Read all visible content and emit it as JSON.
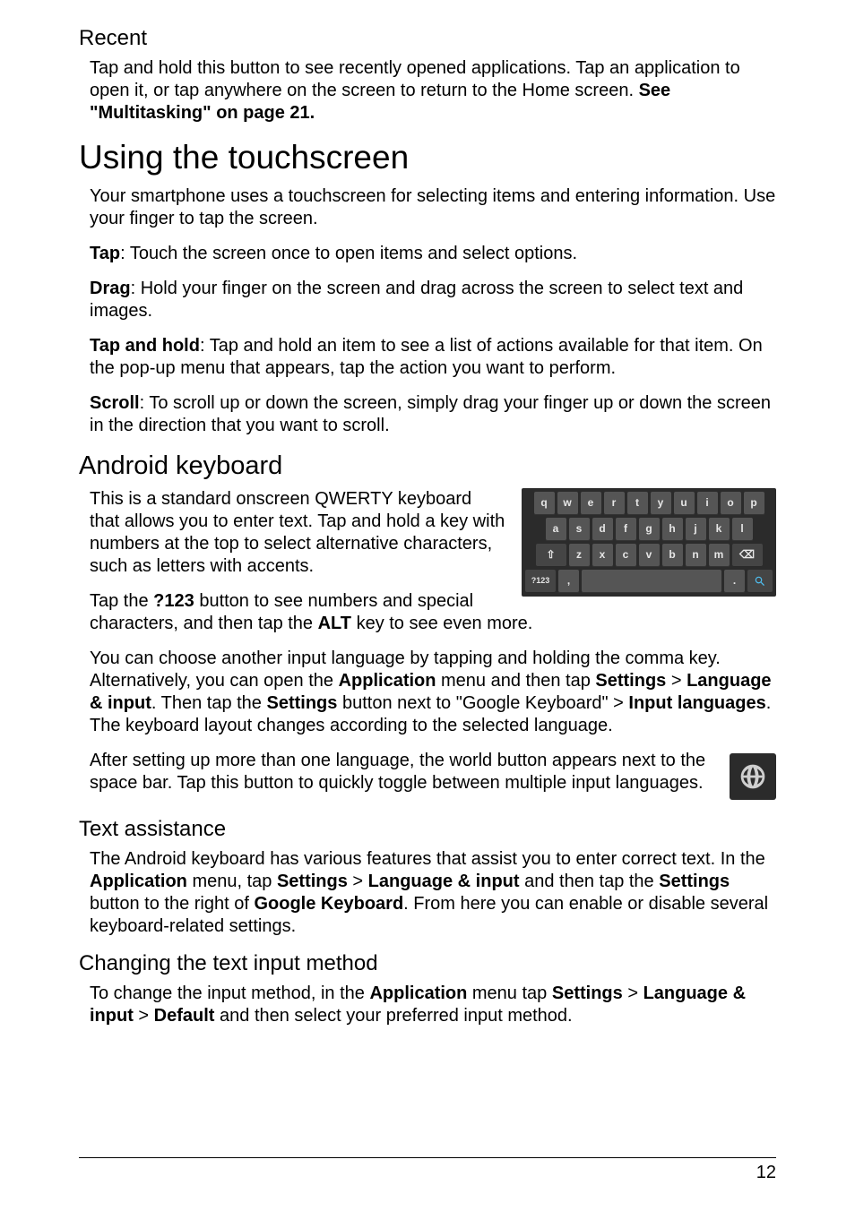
{
  "recent": {
    "heading": "Recent",
    "body_pre": "Tap and hold this button to see recently opened applications. Tap an application to open it, or tap anywhere on the screen to return to the Home screen. ",
    "body_bold": "See \"Multitasking\" on page 21."
  },
  "using_touchscreen": {
    "heading": "Using the touchscreen",
    "p1": "Your smartphone uses a touchscreen for selecting items and entering information. Use your finger to tap the screen.",
    "tap_label": "Tap",
    "tap_body": ": Touch the screen once to open items and select options.",
    "drag_label": "Drag",
    "drag_body": ": Hold your finger on the screen and drag across the screen to select text and images.",
    "taphold_label": "Tap and hold",
    "taphold_body": ": Tap and hold an item to see a list of actions available for that item. On the pop-up menu that appears, tap the action you want to perform.",
    "scroll_label": "Scroll",
    "scroll_body": ": To scroll up or down the screen, simply drag your finger up or down the screen in the direction that you want to scroll."
  },
  "android_keyboard": {
    "heading": "Android keyboard",
    "p1": "This is a standard onscreen QWERTY keyboard that allows you to enter text. Tap and hold a key with numbers at the top to select alternative characters, such as letters with accents.",
    "p2_pre": "Tap the ",
    "p2_bold1": "?123",
    "p2_mid": " button to see numbers and special characters, and then tap the ",
    "p2_bold2": "ALT",
    "p2_post": " key to see even more.",
    "p3_pre": "You can choose another input language by tapping and holding the comma key. Alternatively, you can open the ",
    "p3_b1": "Application",
    "p3_t1": " menu and then tap ",
    "p3_b2": "Settings",
    "p3_t2": " > ",
    "p3_b3": "Language & input",
    "p3_t3": ". Then tap the ",
    "p3_b4": "Settings",
    "p3_t4": " button next to \"Google Keyboard\" > ",
    "p3_b5": "Input languages",
    "p3_t5": ". The keyboard layout changes according to the selected language.",
    "p4": "After setting up more than one language, the world button appears next to the space bar. Tap this button to quickly toggle between multiple input languages."
  },
  "keyboard_rows": {
    "r1": [
      "q",
      "w",
      "e",
      "r",
      "t",
      "y",
      "u",
      "i",
      "o",
      "p"
    ],
    "r2": [
      "a",
      "s",
      "d",
      "f",
      "g",
      "h",
      "j",
      "k",
      "l"
    ],
    "r3_shift": "⇧",
    "r3": [
      "z",
      "x",
      "c",
      "v",
      "b",
      "n",
      "m"
    ],
    "r3_bksp": "⌫",
    "r4_num": "?123",
    "r4_comma": ",",
    "r4_dot": ".",
    "r4_search": "🔍"
  },
  "text_assistance": {
    "heading": "Text assistance",
    "p_pre": "The Android keyboard has various features that assist you to enter correct text. In the ",
    "b1": "Application",
    "t1": " menu, tap ",
    "b2": "Settings",
    "t2": " > ",
    "b3": "Language & input",
    "t3": " and then tap the ",
    "b4": "Settings",
    "t4": " button to the right of ",
    "b5": "Google Keyboard",
    "t5": ". From here you can enable or disable several keyboard-related settings."
  },
  "changing_input": {
    "heading": "Changing the text input method",
    "p_pre": "To change the input method, in the ",
    "b1": "Application",
    "t1": " menu tap ",
    "b2": "Settings",
    "t2": " > ",
    "b3": "Language & input",
    "t3": " > ",
    "b4": "Default",
    "t4": " and then select your preferred input method."
  },
  "page_number": "12"
}
